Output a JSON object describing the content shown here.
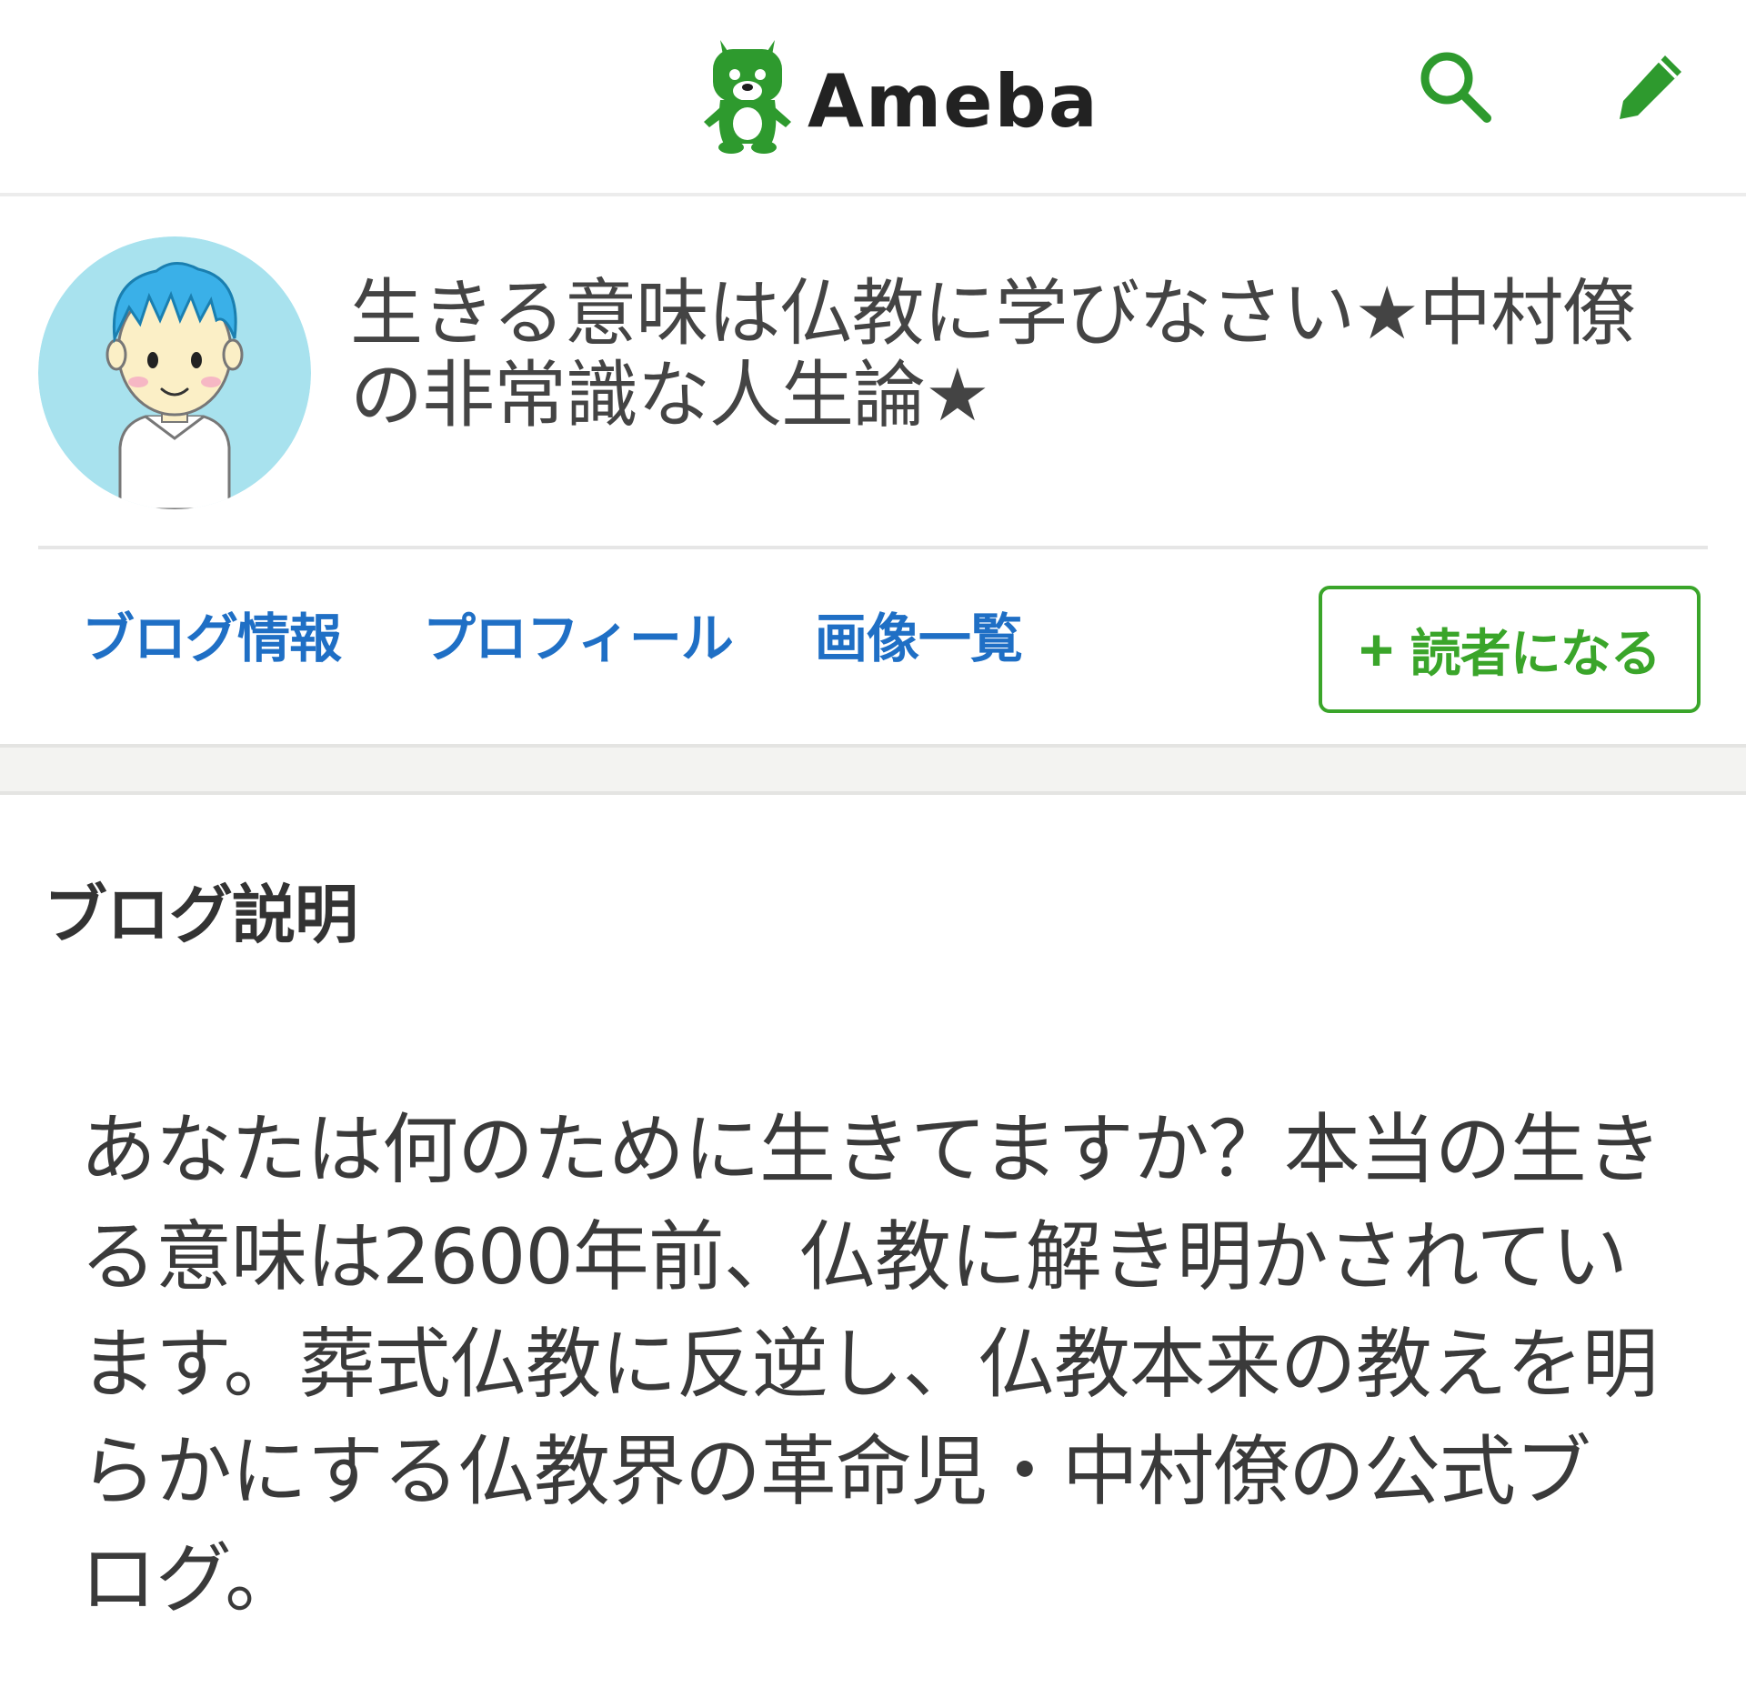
{
  "header": {
    "logo_text": "Ameba",
    "search_icon": "search-icon",
    "write_icon": "pencil-icon"
  },
  "colors": {
    "brand_green": "#2e9a2e",
    "link_blue": "#1f6fc5",
    "follow_green": "#3aa52a"
  },
  "blog": {
    "title": "生きる意味は仏教に学びなさい★中村僚の非常識な人生論★",
    "nav": {
      "info": "ブログ情報",
      "profile": "プロフィール",
      "images": "画像一覧"
    },
    "follow": {
      "plus": "+",
      "label": "読者になる"
    }
  },
  "description": {
    "heading": "ブログ説明",
    "text": "あなたは何のために生きてますか？本当の生きる意味は2600年前、仏教に解き明かされています。葬式仏教に反逆し、仏教本来の教えを明らかにする仏教界の革命児・中村僚の公式ブログ。"
  }
}
